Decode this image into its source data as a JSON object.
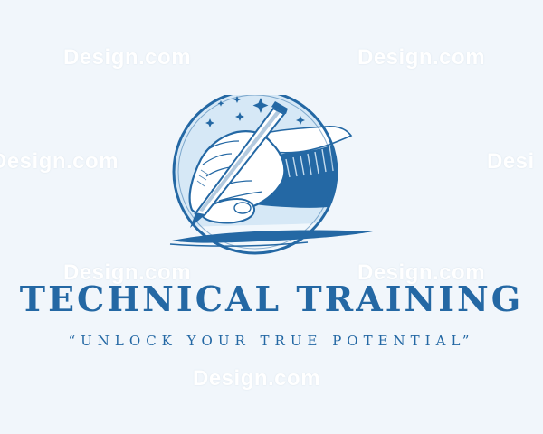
{
  "watermark": {
    "text_1": "Design.com",
    "text_2": "Design.com",
    "text_3": "Design.com",
    "text_4": "Desi",
    "text_5": "Design.com",
    "text_6": "Design.com",
    "text_7": "Design.com"
  },
  "logo": {
    "title": "TECHNICAL TRAINING",
    "tagline": "“UNLOCK YOUR TRUE POTENTIAL”"
  },
  "colors": {
    "background": "#f1f6fb",
    "primary_blue": "#2468a4",
    "light_blue": "#d6e8f6",
    "dark_blue": "#1d5b95"
  }
}
